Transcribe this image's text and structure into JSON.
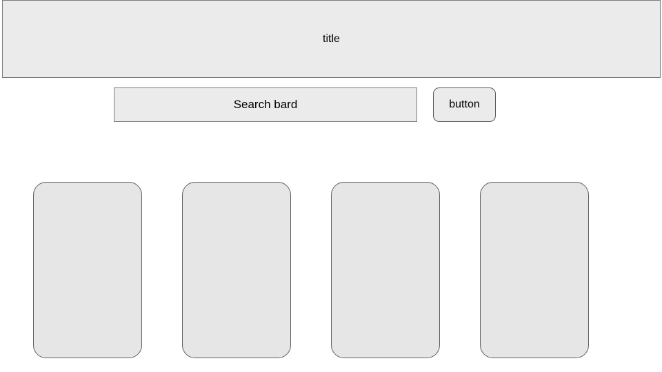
{
  "header": {
    "title": "title"
  },
  "search": {
    "placeholder": "Search bard",
    "button_label": "button"
  },
  "cards": [
    {},
    {},
    {},
    {}
  ]
}
